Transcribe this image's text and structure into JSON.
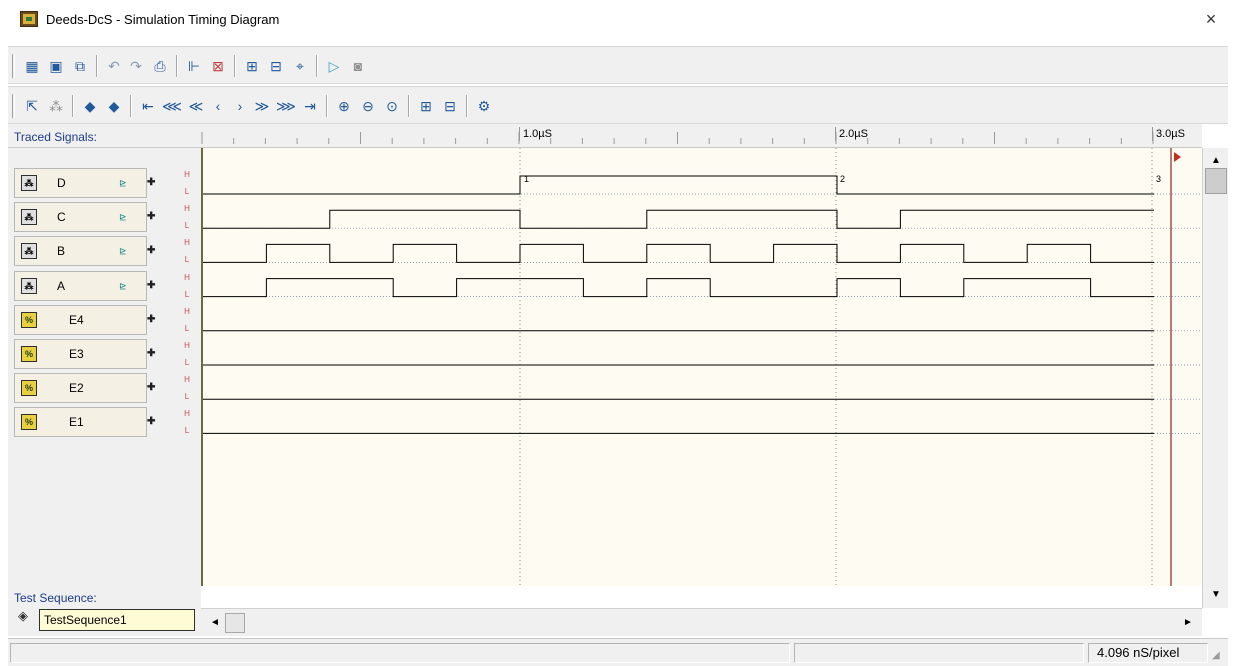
{
  "window": {
    "title": "Deeds-DcS  -  Simulation Timing Diagram",
    "close_glyph": "×"
  },
  "toolbar1": {
    "buttons": [
      "new-diagram-icon",
      "save-icon",
      "export-icon",
      "undo-icon",
      "redo-icon",
      "print-icon",
      "insert-signal-icon",
      "edit-signal-icon",
      "arrange-icon",
      "assign-icon",
      "trace-icon",
      "run-icon",
      "stop-icon"
    ]
  },
  "toolbar2": {
    "buttons": [
      "select-icon",
      "transform-icon",
      "back-icon",
      "forward-icon",
      "goto-start-icon",
      "fast-rewind-icon",
      "rewind-icon",
      "step-back-icon",
      "step-forward-icon",
      "forward-fast-icon",
      "fast-forward-icon",
      "goto-end-icon",
      "zoom-in-icon",
      "zoom-out-icon",
      "zoom-fit-icon",
      "expand-icon",
      "collapse-icon",
      "settings-icon"
    ]
  },
  "panel": {
    "header": "Traced Signals:",
    "h_letter": "H",
    "l_letter": "L"
  },
  "signals": [
    {
      "name": "D",
      "kind": "input"
    },
    {
      "name": "C",
      "kind": "input"
    },
    {
      "name": "B",
      "kind": "input"
    },
    {
      "name": "A",
      "kind": "input"
    },
    {
      "name": "E4",
      "kind": "output"
    },
    {
      "name": "E3",
      "kind": "output"
    },
    {
      "name": "E2",
      "kind": "output"
    },
    {
      "name": "E1",
      "kind": "output"
    }
  ],
  "ruler": {
    "labels": [
      "1.0µS",
      "2.0µS",
      "3.0µS"
    ]
  },
  "markers": [
    "1",
    "2",
    "3"
  ],
  "waveforms": {
    "D": [
      0,
      0,
      0,
      0,
      0,
      1,
      1,
      1,
      1,
      1,
      0,
      0,
      0,
      0,
      0
    ],
    "C": [
      0,
      0,
      1,
      1,
      1,
      0,
      0,
      1,
      1,
      1,
      0,
      1,
      1,
      1,
      1
    ],
    "B": [
      0,
      1,
      0,
      1,
      0,
      1,
      0,
      1,
      0,
      1,
      0,
      1,
      0,
      1,
      0
    ],
    "A": [
      0,
      1,
      1,
      0,
      1,
      1,
      0,
      1,
      0,
      0,
      1,
      0,
      1,
      1,
      0
    ]
  },
  "test_sequence": {
    "label": "Test Sequence:",
    "value": "TestSequence1"
  },
  "statusbar": {
    "zoom": "4.096 nS/pixel"
  },
  "scrollbar": {
    "up": "▲",
    "down": "▼",
    "left": "◄",
    "right": "►"
  }
}
